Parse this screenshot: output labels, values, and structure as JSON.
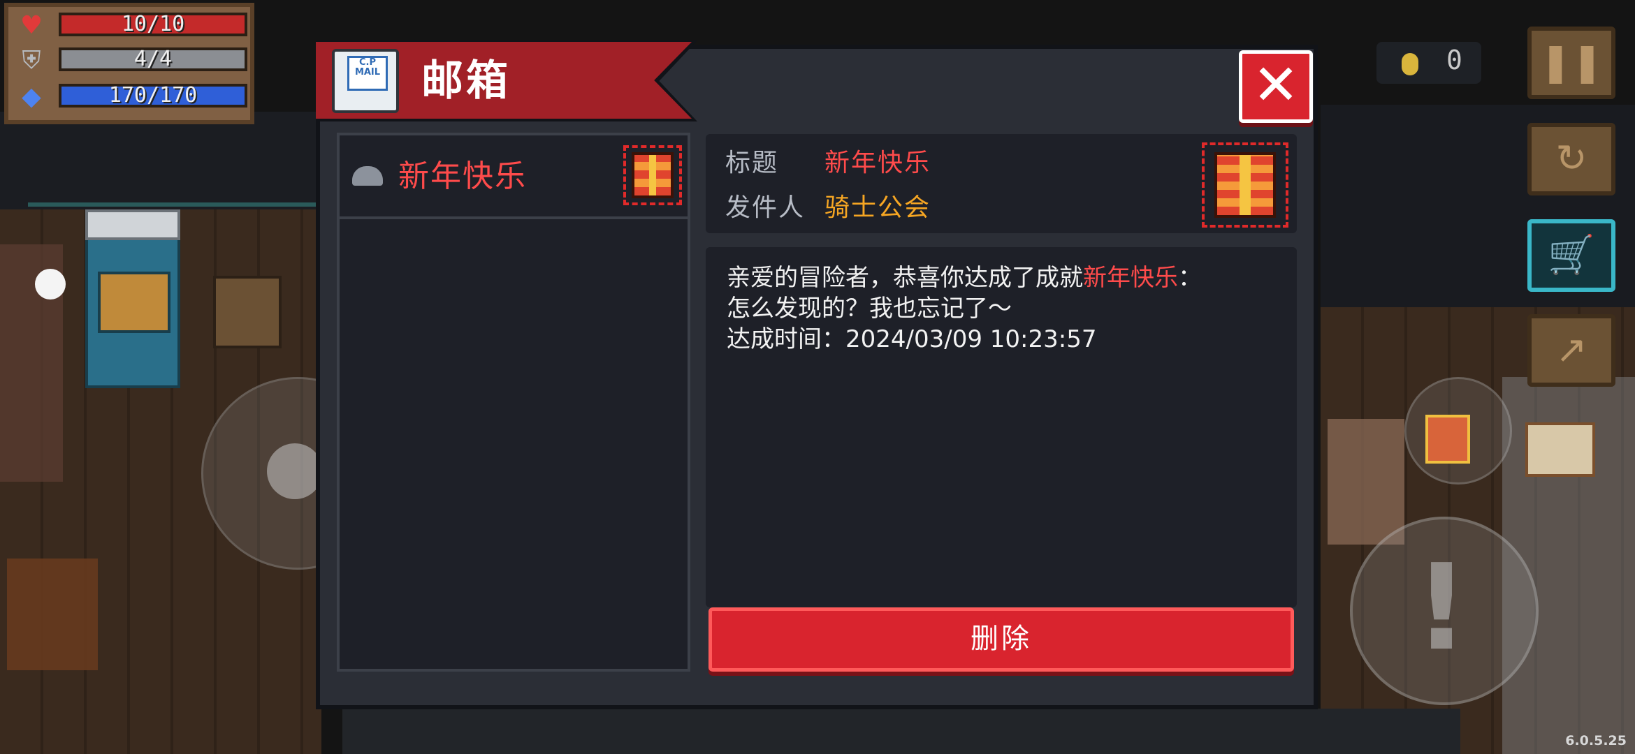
{
  "hud": {
    "hp": "10/10",
    "armor": "4/4",
    "energy": "170/170",
    "hp_icon": "heart-icon",
    "armor_icon": "shield-icon",
    "energy_icon": "diamond-icon",
    "gold": "0"
  },
  "mailbox": {
    "title": "邮箱",
    "mail_icon_text": "C.P MAIL",
    "close_icon": "close-icon",
    "list": [
      {
        "name": "新年快乐",
        "status_icon": "opened-mail-icon",
        "attachment_icon": "gift-icon"
      }
    ],
    "detail": {
      "subject_label": "标题",
      "subject": "新年快乐",
      "sender_label": "发件人",
      "sender": "骑士公会",
      "body_line1_prefix": "亲爱的冒险者，恭喜你达成了成就",
      "body_line1_highlight": "新年快乐",
      "body_line1_suffix": "：",
      "body_line2": "怎么发现的？我也忘记了～",
      "body_line3": "达成时间：2024/03/09 10:23:57"
    },
    "delete_label": "删除"
  },
  "controls": {
    "pause_icon": "pause-icon",
    "swap_icon": "swap-icon",
    "shop_icon": "shopping-cart-icon",
    "interact_icon": "exit-icon",
    "skill_icon": "skill-icon"
  },
  "version": "6.0.5.25",
  "colors": {
    "panel_bg": "#2b2e36",
    "title_red": "#a12027",
    "highlight_red": "#ff4b4b",
    "sender_orange": "#f6a623",
    "button_red": "#d9242e"
  }
}
